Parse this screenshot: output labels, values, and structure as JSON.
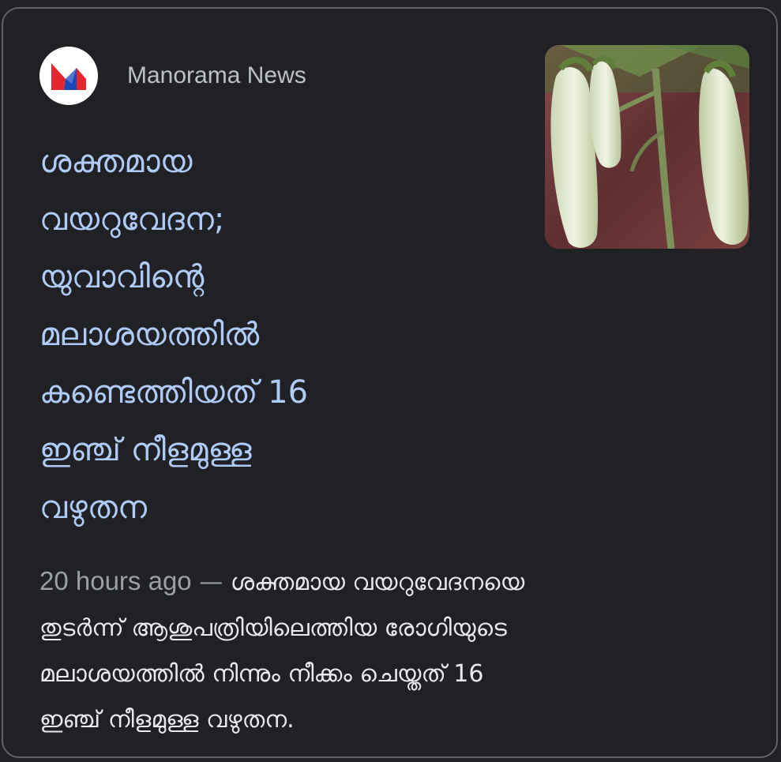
{
  "source": {
    "name": "Manorama News",
    "logo": "manorama-news-logo"
  },
  "headline": "ശക്തമായ\nവയറുവേദന;\nയുവാവിന്റെ\nമലാശയത്തിൽ\nകണ്ടെത്തിയത് 16\nഇഞ്ച് നീളമുള്ള\nവഴുതന",
  "thumbnail": {
    "subject": "white eggplants on plant"
  },
  "snippet": {
    "time": "20 hours ago",
    "separator": "—",
    "text": "ശക്തമായ വയറുവേദനയെ\nതുടർന്ന് ആശുപത്രിയിലെത്തിയ രോഗിയുടെ\nമലാശയത്തിൽ നിന്നും നീക്കം ചെയ്തത് 16\nഇഞ്ച് നീളമുള്ള വഴുതന."
  },
  "colors": {
    "background": "#202124",
    "card_border": "#5f6368",
    "headline": "#aecbfa",
    "source_text": "#bdc1c6",
    "time_text": "#9aa0a6",
    "snippet_text": "#e8eaed",
    "logo_red": "#e3262e",
    "logo_blue": "#1a47b8"
  }
}
